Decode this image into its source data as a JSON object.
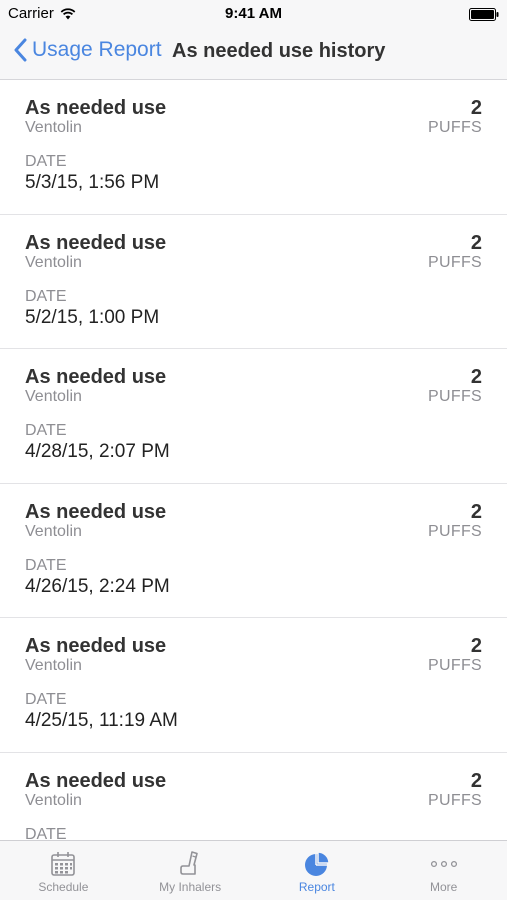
{
  "status": {
    "carrier": "Carrier",
    "time": "9:41 AM"
  },
  "nav": {
    "back_label": "Usage Report",
    "title": "As needed use history"
  },
  "entries": [
    {
      "title": "As needed use",
      "medication": "Ventolin",
      "count": "2",
      "unit": "PUFFS",
      "date_label": "DATE",
      "date": "5/3/15, 1:56 PM"
    },
    {
      "title": "As needed use",
      "medication": "Ventolin",
      "count": "2",
      "unit": "PUFFS",
      "date_label": "DATE",
      "date": "5/2/15, 1:00 PM"
    },
    {
      "title": "As needed use",
      "medication": "Ventolin",
      "count": "2",
      "unit": "PUFFS",
      "date_label": "DATE",
      "date": "4/28/15, 2:07 PM"
    },
    {
      "title": "As needed use",
      "medication": "Ventolin",
      "count": "2",
      "unit": "PUFFS",
      "date_label": "DATE",
      "date": "4/26/15, 2:24 PM"
    },
    {
      "title": "As needed use",
      "medication": "Ventolin",
      "count": "2",
      "unit": "PUFFS",
      "date_label": "DATE",
      "date": "4/25/15, 11:19 AM"
    },
    {
      "title": "As needed use",
      "medication": "Ventolin",
      "count": "2",
      "unit": "PUFFS",
      "date_label": "DATE",
      "date": ""
    }
  ],
  "tabs": [
    {
      "label": "Schedule",
      "icon": "calendar-icon",
      "active": false
    },
    {
      "label": "My Inhalers",
      "icon": "inhaler-icon",
      "active": false
    },
    {
      "label": "Report",
      "icon": "pie-chart-icon",
      "active": true
    },
    {
      "label": "More",
      "icon": "more-dots-icon",
      "active": false
    }
  ],
  "colors": {
    "accent": "#4a86e0",
    "inactive": "#929297",
    "bar_background": "#f7f7f8"
  }
}
